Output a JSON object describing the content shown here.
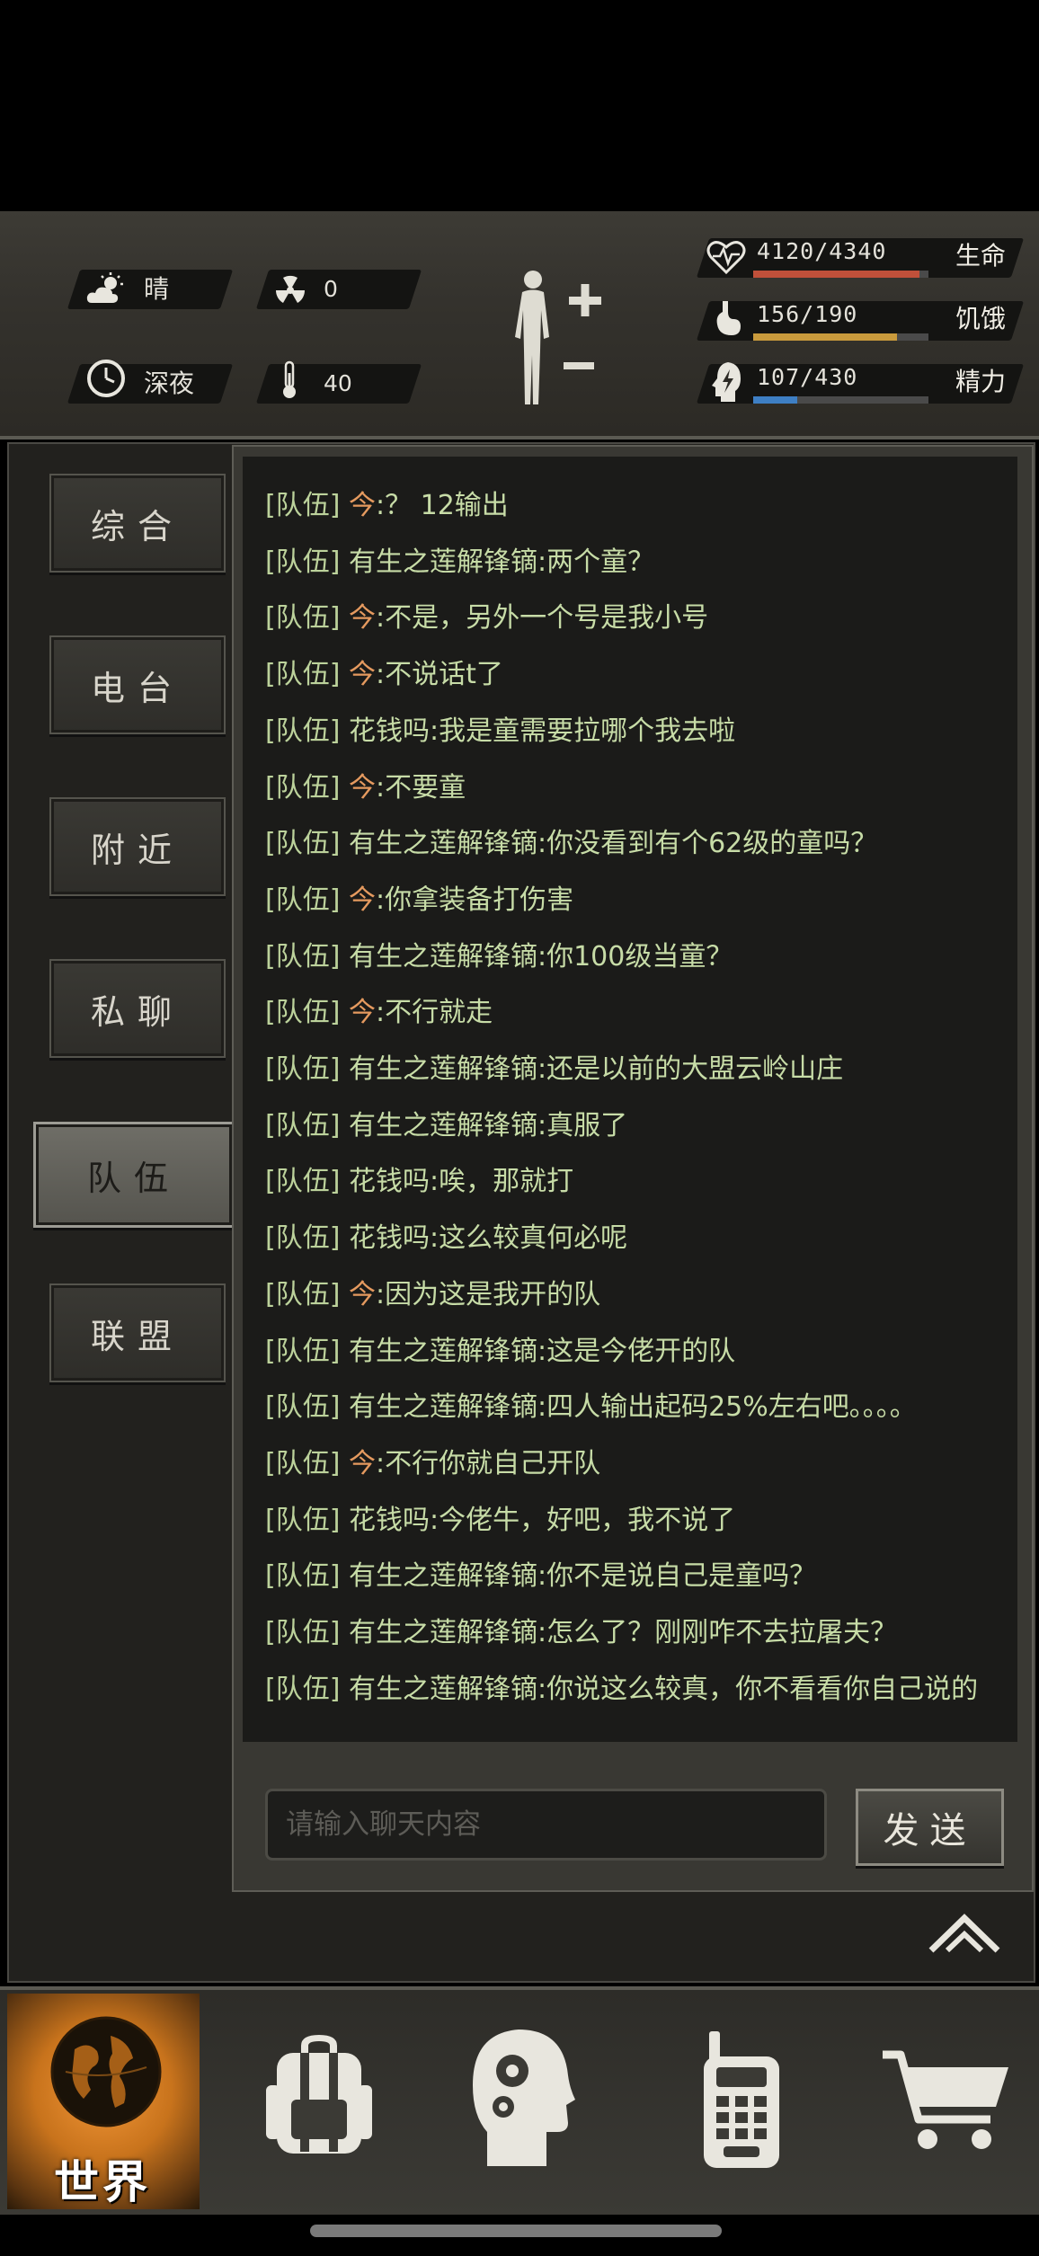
{
  "status": {
    "weather": {
      "icon": "weather-sun-cloud-icon",
      "label": "晴"
    },
    "radiation": {
      "icon": "radiation-icon",
      "value": "0"
    },
    "time_of_day": {
      "icon": "clock-icon",
      "label": "深夜"
    },
    "temperature": {
      "icon": "thermometer-icon",
      "value": "40"
    },
    "body_icon": "body-figure-icon",
    "stats": [
      {
        "name": "health",
        "icon": "heart-icon",
        "value": "4120/4340",
        "label": "生命",
        "fill": 0.949,
        "color": "#c0503a"
      },
      {
        "name": "hunger",
        "icon": "stomach-icon",
        "value": "156/190",
        "label": "饥饿",
        "fill": 0.821,
        "color": "#c99a3c"
      },
      {
        "name": "energy",
        "icon": "energy-icon",
        "value": "107/430",
        "label": "精力",
        "fill": 0.249,
        "color": "#3e7fc4"
      }
    ]
  },
  "tabs": [
    {
      "label": "综合",
      "active": false
    },
    {
      "label": "电台",
      "active": false
    },
    {
      "label": "附近",
      "active": false
    },
    {
      "label": "私聊",
      "active": false
    },
    {
      "label": "队伍",
      "active": true
    },
    {
      "label": "联盟",
      "active": false
    }
  ],
  "chat": {
    "messages": [
      {
        "channel": "[队伍]",
        "sender": "今",
        "self": true,
        "text": ":？ 12输出"
      },
      {
        "channel": "[队伍]",
        "sender": "有生之莲解锋镝",
        "self": false,
        "text": ":两个童？"
      },
      {
        "channel": "[队伍]",
        "sender": "今",
        "self": true,
        "text": ":不是，另外一个号是我小号"
      },
      {
        "channel": "[队伍]",
        "sender": "今",
        "self": true,
        "text": ":不说话t了"
      },
      {
        "channel": "[队伍]",
        "sender": "花钱吗",
        "self": false,
        "text": ":我是童需要拉哪个我去啦"
      },
      {
        "channel": "[队伍]",
        "sender": "今",
        "self": true,
        "text": ":不要童"
      },
      {
        "channel": "[队伍]",
        "sender": "有生之莲解锋镝",
        "self": false,
        "text": ":你没看到有个62级的童吗？"
      },
      {
        "channel": "[队伍]",
        "sender": "今",
        "self": true,
        "text": ":你拿装备打伤害"
      },
      {
        "channel": "[队伍]",
        "sender": "有生之莲解锋镝",
        "self": false,
        "text": ":你100级当童？"
      },
      {
        "channel": "[队伍]",
        "sender": "今",
        "self": true,
        "text": ":不行就走"
      },
      {
        "channel": "[队伍]",
        "sender": "有生之莲解锋镝",
        "self": false,
        "text": ":还是以前的大盟云岭山庄"
      },
      {
        "channel": "[队伍]",
        "sender": "有生之莲解锋镝",
        "self": false,
        "text": ":真服了"
      },
      {
        "channel": "[队伍]",
        "sender": "花钱吗",
        "self": false,
        "text": ":唉，那就打"
      },
      {
        "channel": "[队伍]",
        "sender": "花钱吗",
        "self": false,
        "text": ":这么较真何必呢"
      },
      {
        "channel": "[队伍]",
        "sender": "今",
        "self": true,
        "text": ":因为这是我开的队"
      },
      {
        "channel": "[队伍]",
        "sender": "有生之莲解锋镝",
        "self": false,
        "text": ":这是今佬开的队"
      },
      {
        "channel": "[队伍]",
        "sender": "有生之莲解锋镝",
        "self": false,
        "text": ":四人输出起码25%左右吧。。。。"
      },
      {
        "channel": "[队伍]",
        "sender": "今",
        "self": true,
        "text": ":不行你就自己开队"
      },
      {
        "channel": "[队伍]",
        "sender": "花钱吗",
        "self": false,
        "text": ":今佬牛，好吧，我不说了"
      },
      {
        "channel": "[队伍]",
        "sender": "有生之莲解锋镝",
        "self": false,
        "text": ":你不是说自己是童吗？"
      },
      {
        "channel": "[队伍]",
        "sender": "有生之莲解锋镝",
        "self": false,
        "text": ":怎么了？刚刚咋不去拉屠夫？"
      },
      {
        "channel": "[队伍]",
        "sender": "有生之莲解锋镝",
        "self": false,
        "text": ":你说这么较真，你不看看你自己说的"
      }
    ],
    "input_placeholder": "请输入聊天内容",
    "send_label": "发送"
  },
  "collapse_icon": "double-chevron-up-icon",
  "nav": [
    {
      "name": "world",
      "icon": "globe-icon",
      "label": "世界",
      "active": true
    },
    {
      "name": "inventory",
      "icon": "backpack-icon",
      "label": "",
      "active": false
    },
    {
      "name": "skills",
      "icon": "head-gears-icon",
      "label": "",
      "active": false
    },
    {
      "name": "radio",
      "icon": "walkie-talkie-icon",
      "label": "",
      "active": false
    },
    {
      "name": "shop",
      "icon": "shopping-cart-icon",
      "label": "",
      "active": false
    }
  ]
}
